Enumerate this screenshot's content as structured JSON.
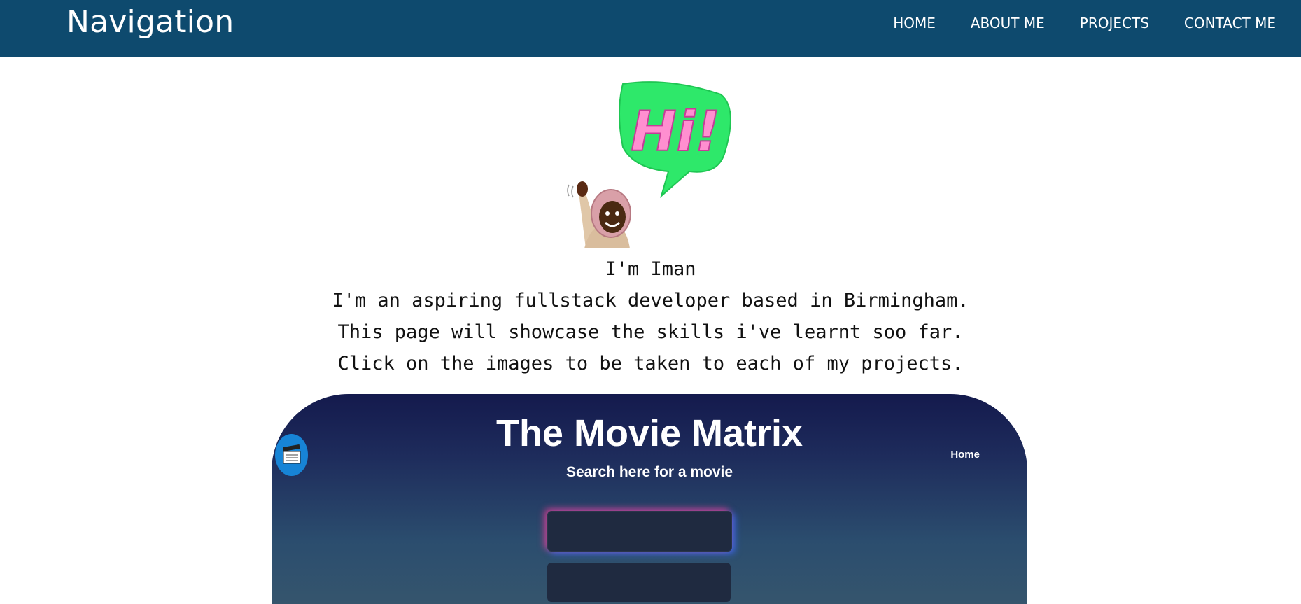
{
  "nav": {
    "brand": "Navigation",
    "links": [
      "HOME",
      "ABOUT ME",
      "PROJECTS",
      "CONTACT ME"
    ]
  },
  "hero": {
    "bubble_text": "Hi!"
  },
  "intro": {
    "lines": [
      "I'm Iman",
      "I'm an aspiring fullstack developer based in Birmingham.",
      "This page will showcase the skills i've learnt soo far.",
      "Click on the images to be taken to each of my projects."
    ]
  },
  "project": {
    "title": "The Movie Matrix",
    "subtitle": "Search here for a movie",
    "home_link": "Home"
  },
  "colors": {
    "navbar": "#0e4a6e",
    "bubble": "#2ee86a",
    "bubble_text": "#ff8fd0",
    "card_top": "#141a4d",
    "card_bottom": "#35556d"
  }
}
